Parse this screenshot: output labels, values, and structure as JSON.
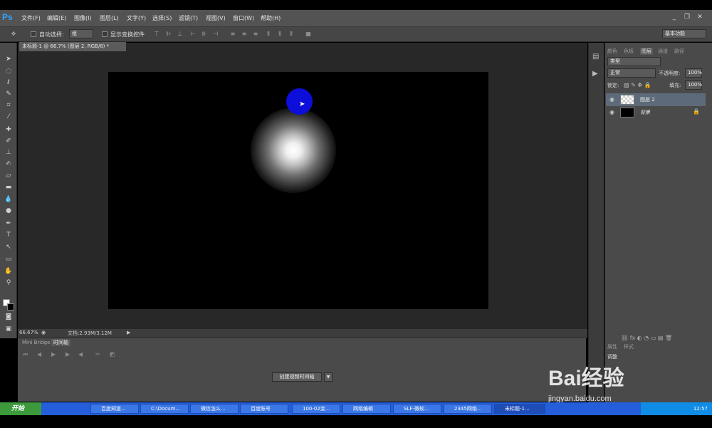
{
  "app": {
    "logo": "Ps"
  },
  "menu": [
    "文件(F)",
    "编辑(E)",
    "图像(I)",
    "图层(L)",
    "文字(Y)",
    "选择(S)",
    "滤镜(T)",
    "视图(V)",
    "窗口(W)",
    "帮助(H)"
  ],
  "options_bar": {
    "auto_select_label": "自动选择:",
    "auto_select_value": "组",
    "show_transform_label": "显示变换控件",
    "workspace": "基本功能"
  },
  "document": {
    "tab_title": "未标题-1 @ 66.7% (图层 2, RGB/8) *",
    "zoom": "66.67%",
    "doc_size": "文档:2.93M/3.12M"
  },
  "timeline": {
    "tab_minibridge": "Mini Bridge",
    "tab_timeline": "时间轴",
    "create_button": "创建视频时间轴"
  },
  "layers_panel": {
    "tabs": [
      "颜色",
      "色板",
      "图层",
      "通道",
      "路径"
    ],
    "kind_label": "类型",
    "blend_mode": "正常",
    "opacity_label": "不透明度:",
    "opacity_value": "100%",
    "lock_label": "锁定:",
    "fill_label": "填充:",
    "fill_value": "100%",
    "layers": [
      {
        "name": "图层 2"
      },
      {
        "name": "背景"
      }
    ],
    "lower_tabs": [
      "属性",
      "样式"
    ],
    "lower_text": "调整"
  },
  "taskbar": {
    "start": "开始",
    "tasks": [
      "百度知道...",
      "C:\\Docum...",
      "微信怎么...",
      "百度账号",
      "100-02变...",
      "网络编辑",
      "SLF-微软...",
      "2345网络...",
      "未标题-1..."
    ],
    "active_task_index": 8,
    "clock": "12:57"
  },
  "watermark": {
    "logo": "Bai经验",
    "url": "jingyan.baidu.com"
  },
  "colors": {
    "menubar": "#535353",
    "panel": "#4a4a4a",
    "canvas_bg": "#282828",
    "cursor_dot": "#0e0edb",
    "taskbar": "#245edb"
  }
}
